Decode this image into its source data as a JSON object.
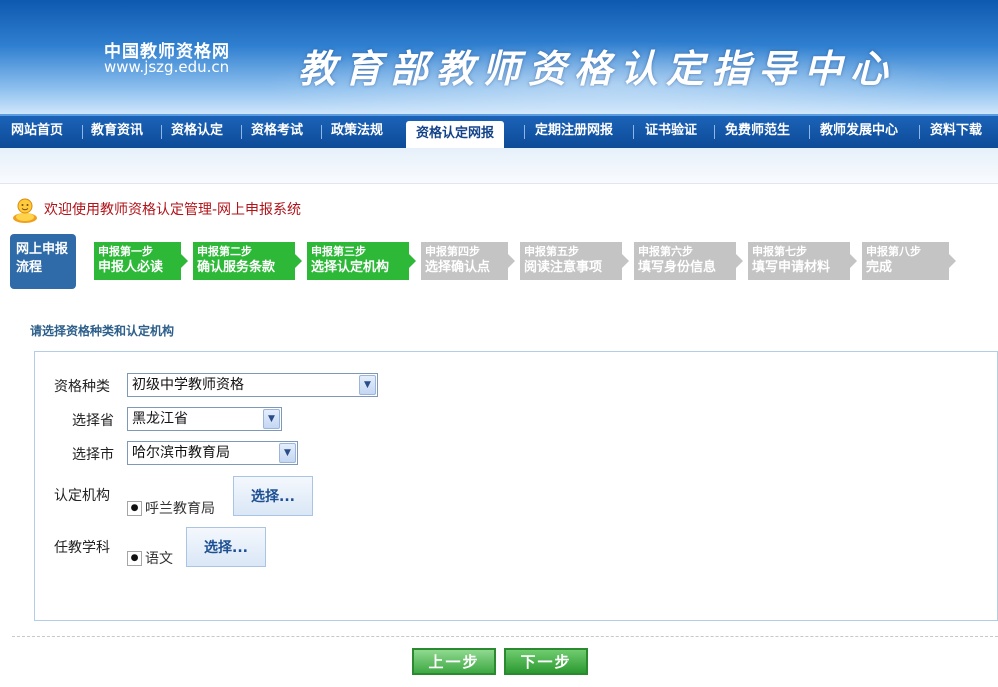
{
  "header": {
    "site_name": "中国教师资格网",
    "site_url": "www.jszg.edu.cn",
    "org_title": "教育部教师资格认定指导中心"
  },
  "nav": {
    "items": [
      {
        "label": "网站首页"
      },
      {
        "label": "教育资讯"
      },
      {
        "label": "资格认定"
      },
      {
        "label": "资格考试"
      },
      {
        "label": "政策法规"
      },
      {
        "label": "资格认定网报",
        "active": true
      },
      {
        "label": "定期注册网报"
      },
      {
        "label": "证书验证"
      },
      {
        "label": "免费师范生"
      },
      {
        "label": "教师发展中心"
      },
      {
        "label": "资料下载"
      }
    ]
  },
  "welcome": {
    "text": "欢迎使用教师资格认定管理-网上申报系统",
    "icon": "user-icon"
  },
  "steps": {
    "label": "网上申报流程",
    "items": [
      {
        "num": "申报第一步",
        "name": "申报人必读",
        "state": "done"
      },
      {
        "num": "申报第二步",
        "name": "确认服务条款",
        "state": "done"
      },
      {
        "num": "申报第三步",
        "name": "选择认定机构",
        "state": "done"
      },
      {
        "num": "申报第四步",
        "name": "选择确认点",
        "state": "todo"
      },
      {
        "num": "申报第五步",
        "name": "阅读注意事项",
        "state": "todo"
      },
      {
        "num": "申报第六步",
        "name": "填写身份信息",
        "state": "todo"
      },
      {
        "num": "申报第七步",
        "name": "填写申请材料",
        "state": "todo"
      },
      {
        "num": "申报第八步",
        "name": "完成",
        "state": "todo"
      }
    ]
  },
  "form": {
    "section_title": "请选择资格种类和认定机构",
    "cert_type_label": "资格种类",
    "cert_type_value": "初级中学教师资格",
    "province_label": "选择省",
    "province_value": "黑龙江省",
    "city_label": "选择市",
    "city_value": "哈尔滨市教育局",
    "agency_label": "认定机构",
    "agency_value": "呼兰教育局",
    "agency_button": "选择...",
    "subject_label": "任教学科",
    "subject_value": "语文",
    "subject_button": "选择..."
  },
  "actions": {
    "prev": "上一步",
    "next": "下一步"
  },
  "colors": {
    "nav_bg": "#0d4a97",
    "step_done": "#2db838",
    "step_todo": "#c4c4c4",
    "welcome_text": "#b0141a",
    "section_title": "#2d5f8a"
  }
}
